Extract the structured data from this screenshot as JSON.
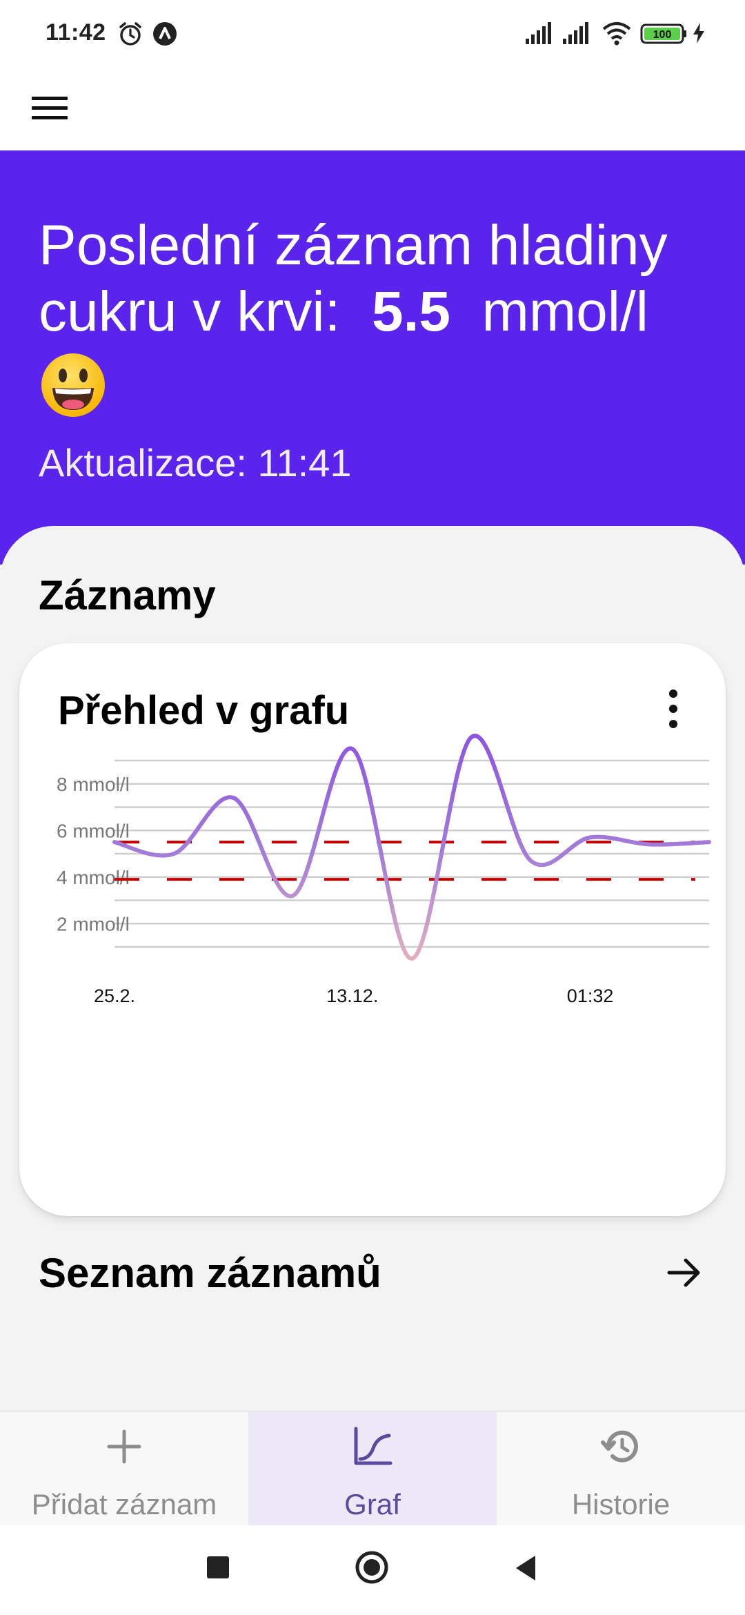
{
  "status_bar": {
    "time": "11:42",
    "battery": "100"
  },
  "hero": {
    "text_prefix": "Poslední záznam hladiny cukru v krvi:",
    "value": "5.5",
    "unit": "mmol/l",
    "update_label": "Aktualizace: 11:41"
  },
  "section_title": "Záznamy",
  "card": {
    "title": "Přehled v grafu"
  },
  "list_link": {
    "title": "Seznam záznamů"
  },
  "bottom_nav": {
    "items": [
      {
        "label": "Přidat záznam",
        "icon": "plus-icon"
      },
      {
        "label": "Graf",
        "icon": "chart-icon",
        "active": true
      },
      {
        "label": "Historie",
        "icon": "history-icon"
      }
    ]
  },
  "colors": {
    "primary": "#5b24ec",
    "line": "#9a6fdb",
    "threshold": "#c00000"
  },
  "chart_data": {
    "type": "line",
    "y_ticks": [
      {
        "label": "8 mmol/l",
        "value": 8
      },
      {
        "label": "6 mmol/l",
        "value": 6
      },
      {
        "label": "4 mmol/l",
        "value": 4
      },
      {
        "label": "2 mmol/l",
        "value": 2
      }
    ],
    "ylim": [
      1,
      9
    ],
    "x_ticks": [
      "25.2.",
      "13.12.",
      "01:32"
    ],
    "series": [
      {
        "values": [
          5.5,
          5.0,
          7.4,
          3.2,
          9.5,
          0.5,
          10.0,
          4.7,
          5.7,
          5.4,
          5.5
        ]
      }
    ],
    "thresholds": [
      5.5,
      3.9
    ],
    "grid": true
  }
}
